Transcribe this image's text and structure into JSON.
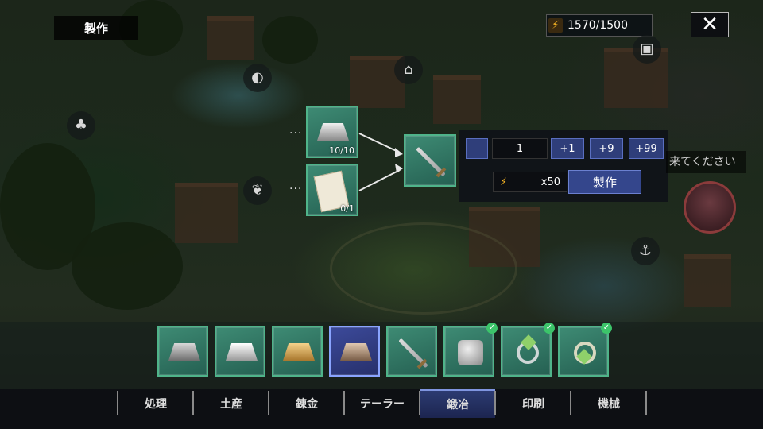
{
  "header": {
    "title": "製作",
    "energy": "1570/1500",
    "close_label": "✕"
  },
  "map_icons": [
    {
      "name": "tree-icon",
      "glyph": "♣"
    },
    {
      "name": "fish-icon",
      "glyph": "◐"
    },
    {
      "name": "house-icon",
      "glyph": "⌂"
    },
    {
      "name": "leaf-icon",
      "glyph": "❦"
    },
    {
      "name": "anchor-icon",
      "glyph": "⚓"
    },
    {
      "name": "building-icon",
      "glyph": "▣"
    }
  ],
  "recipe": {
    "materials": [
      {
        "name": "silver-ingot",
        "qty": "10/10"
      },
      {
        "name": "blueprint",
        "qty": "0/1"
      }
    ],
    "result": "sword",
    "dots": "..."
  },
  "craft_panel": {
    "minus": "—",
    "quantity": "1",
    "plus1": "+1",
    "plus9": "+9",
    "plus99": "+99",
    "cost": "x50",
    "craft_label": "製作"
  },
  "npc": {
    "speech": "来てください"
  },
  "items": [
    {
      "name": "iron-ingot",
      "completed": false
    },
    {
      "name": "silver-ingot",
      "completed": false
    },
    {
      "name": "gold-ingot",
      "completed": false
    },
    {
      "name": "bronze-ingot",
      "completed": false,
      "selected": true
    },
    {
      "name": "sword",
      "completed": false
    },
    {
      "name": "armor",
      "completed": true
    },
    {
      "name": "ring",
      "completed": true
    },
    {
      "name": "necklace",
      "completed": true
    }
  ],
  "tabs": [
    {
      "label": "処理"
    },
    {
      "label": "土産"
    },
    {
      "label": "錬金"
    },
    {
      "label": "テーラー"
    },
    {
      "label": "鍛冶",
      "active": true
    },
    {
      "label": "印刷"
    },
    {
      "label": "機械"
    }
  ],
  "colors": {
    "slot": "#3e8b74",
    "selected": "#3c4a9a",
    "energy": "#f5b324",
    "check": "#3cc46a"
  }
}
